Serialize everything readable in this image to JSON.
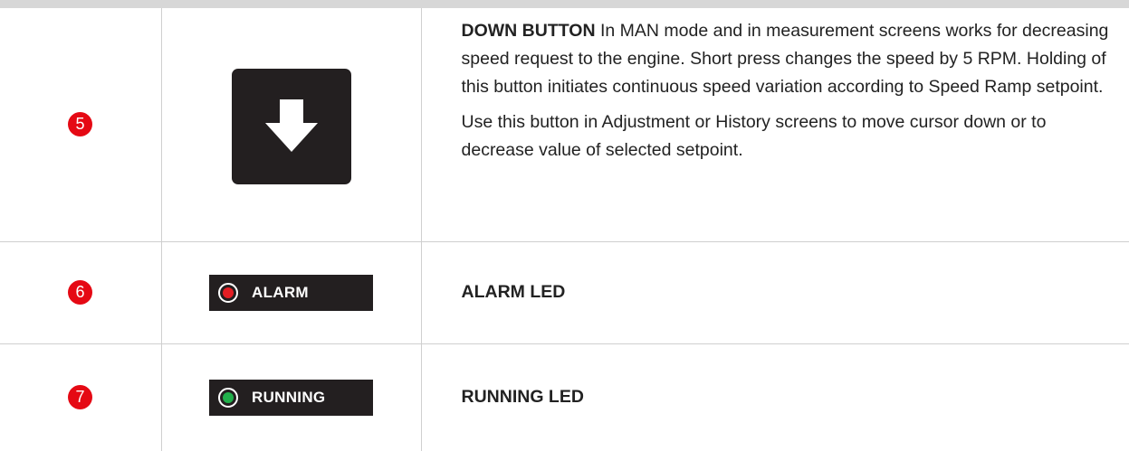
{
  "rows": [
    {
      "number": "5",
      "icon": "down-arrow-icon",
      "title": "DOWN BUTTON",
      "paragraph1": "In MAN mode and in measurement screens works for decreasing speed request to the engine. Short press changes the speed by 5 RPM. Holding of this button initiates continuous speed variation according to Speed Ramp setpoint.",
      "paragraph2": "Use this button in Adjustment or History screens to move cursor down or to decrease value of selected setpoint."
    },
    {
      "number": "6",
      "led_label": "ALARM",
      "led_color": "#e31e24",
      "title": "ALARM LED"
    },
    {
      "number": "7",
      "led_label": "RUNNING",
      "led_color": "#21b04b",
      "title": "RUNNING LED"
    }
  ]
}
